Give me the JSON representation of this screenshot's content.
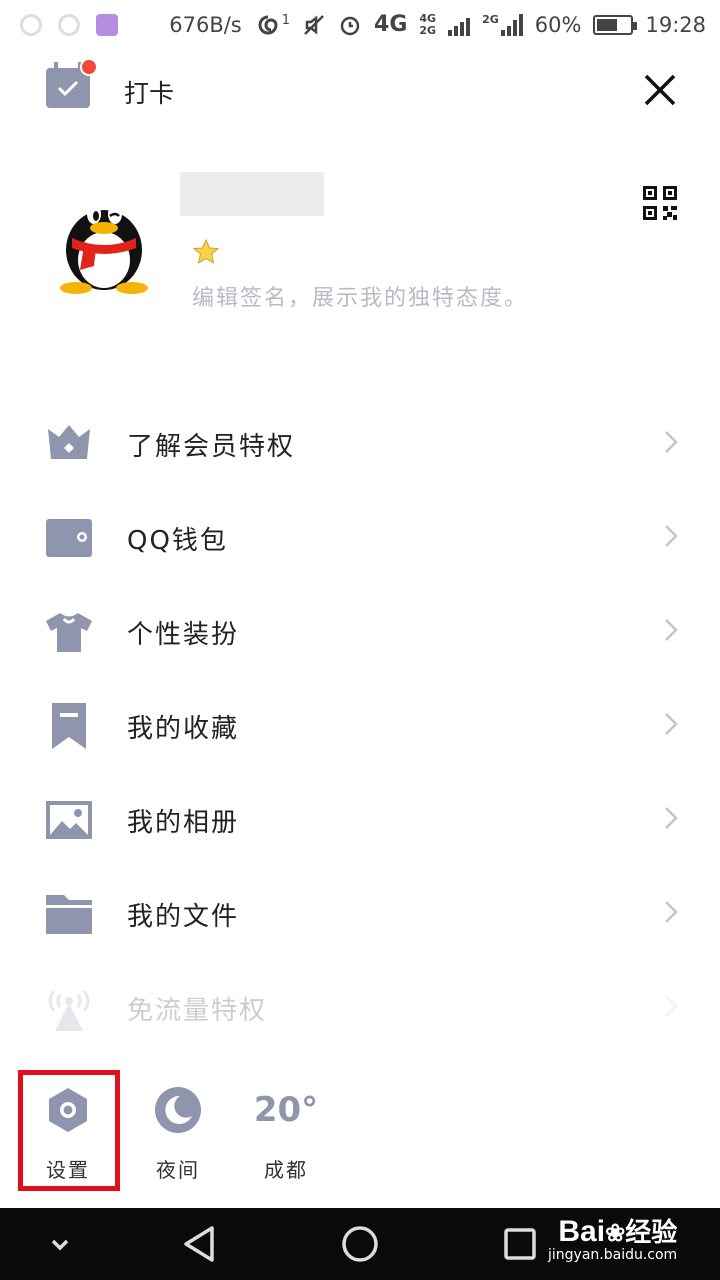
{
  "status_bar": {
    "speed": "676B/s",
    "signal_badge": "1",
    "net_4g": "4G",
    "net_4g2g_top": "4G",
    "net_4g2g_bottom": "2G",
    "net_2g": "2G",
    "battery_percent": "60%",
    "battery_level": 0.6,
    "time": "19:28"
  },
  "header": {
    "checkin_label": "打卡"
  },
  "profile": {
    "signature_placeholder": "编辑签名，展示我的独特态度。"
  },
  "menu": {
    "items": [
      {
        "label": "了解会员特权",
        "icon": "vip-crown-icon"
      },
      {
        "label": "QQ钱包",
        "icon": "wallet-icon"
      },
      {
        "label": "个性装扮",
        "icon": "tshirt-icon"
      },
      {
        "label": "我的收藏",
        "icon": "bookmark-icon"
      },
      {
        "label": "我的相册",
        "icon": "photo-icon"
      },
      {
        "label": "我的文件",
        "icon": "folder-icon"
      },
      {
        "label": "免流量特权",
        "icon": "signal-tower-icon"
      }
    ]
  },
  "tools": {
    "settings_label": "设置",
    "night_label": "夜间",
    "weather_temp": "20°",
    "weather_city": "成都"
  },
  "watermark": {
    "brand": "Bai",
    "brand_cn": "经验",
    "url": "jingyan.baidu.com"
  },
  "colors": {
    "icon_gray": "#8e95ad",
    "highlight_red": "#e0101a",
    "badge_red": "#f04a3c"
  }
}
